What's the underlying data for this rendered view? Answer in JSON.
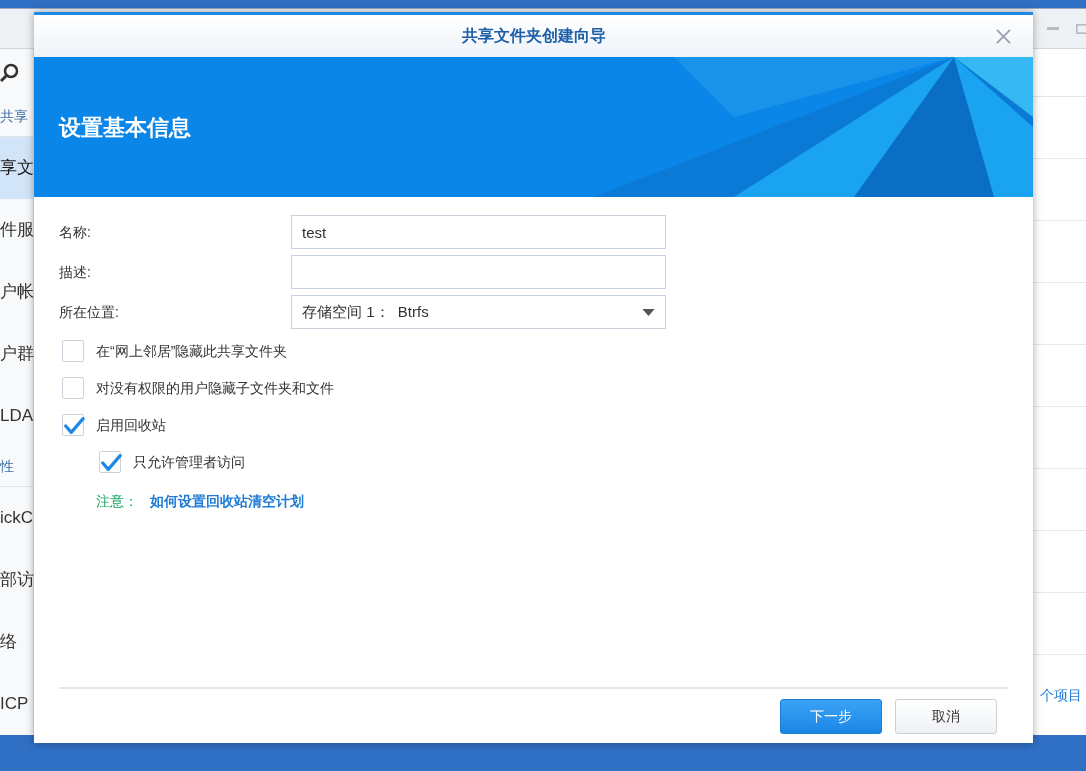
{
  "background_window": {
    "sidebar": {
      "items": [
        {
          "kind": "header",
          "label": "共享"
        },
        {
          "kind": "item",
          "label": "享文",
          "selected": true
        },
        {
          "kind": "item",
          "label": "件服",
          "selected": false
        },
        {
          "kind": "item",
          "label": "户帐",
          "selected": false
        },
        {
          "kind": "item",
          "label": "户群",
          "selected": false
        },
        {
          "kind": "item",
          "label": "LDA",
          "selected": false
        },
        {
          "kind": "header",
          "label": "性"
        },
        {
          "kind": "item",
          "label": "ickC",
          "selected": false
        },
        {
          "kind": "item",
          "label": "部访",
          "selected": false
        },
        {
          "kind": "item",
          "label": "络",
          "selected": false
        },
        {
          "kind": "item",
          "label": "ICP",
          "selected": false
        }
      ]
    },
    "footer_text": "个项目"
  },
  "dialog": {
    "title": "共享文件夹创建向导",
    "banner_title": "设置基本信息",
    "fields": [
      {
        "kind": "text",
        "label": "名称:",
        "value": "test"
      },
      {
        "kind": "text",
        "label": "描述:"
      },
      {
        "kind": "select",
        "label": "所在位置:",
        "value": "存储空间 1：  Btrfs"
      }
    ],
    "checkboxes": [
      {
        "label": "在“网上邻居”隐藏此共享文件夹",
        "checked": false
      },
      {
        "label": "对没有权限的用户隐藏子文件夹和文件",
        "checked": false
      },
      {
        "label": "启用回收站",
        "checked": true,
        "children": [
          {
            "label": "只允许管理者访问",
            "checked": true
          }
        ]
      }
    ],
    "note": {
      "label": "注意：",
      "link": "如何设置回收站清空计划"
    },
    "buttons": [
      {
        "kind": "primary",
        "label": "下一步"
      },
      {
        "kind": "secondary",
        "label": "取消"
      }
    ]
  }
}
